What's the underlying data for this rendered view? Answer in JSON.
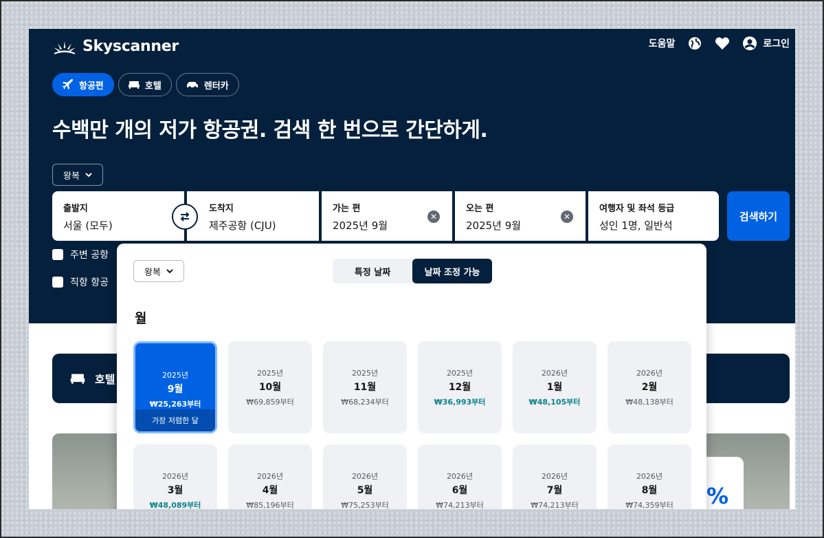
{
  "header": {
    "logo_text": "Skyscanner",
    "help": "도움말",
    "login": "로그인"
  },
  "tabs": [
    {
      "label": "항공편",
      "icon": "airplane-icon",
      "active": true
    },
    {
      "label": "호텔",
      "icon": "bed-icon",
      "active": false
    },
    {
      "label": "렌터카",
      "icon": "car-icon",
      "active": false
    }
  ],
  "headline": "수백만 개의 저가 항공권. 검색 한 번으로 간단하게.",
  "trip_type": "왕복",
  "search": {
    "origin_label": "출발지",
    "origin_value": "서울 (모두)",
    "dest_label": "도착지",
    "dest_value": "제주공항 (CJU)",
    "depart_label": "가는 편",
    "depart_value": "2025년 9월",
    "return_label": "오는 편",
    "return_value": "2025년 9월",
    "travelers_label": "여행자 및 좌석 등급",
    "travelers_value": "성인 1명, 일반석",
    "search_button": "검색하기"
  },
  "options": {
    "nearby": "주변 공항",
    "direct": "직항 항공"
  },
  "hotel_banner": "호텔",
  "promo_symbol": "%",
  "picker": {
    "trip_type": "왕복",
    "mode_specific": "특정 날짜",
    "mode_flexible": "날짜 조정 가능",
    "section_title": "월",
    "months": [
      {
        "year": "2025년",
        "month": "9월",
        "price": "₩25,263부터",
        "cheap": true,
        "selected": true,
        "tag": "가장 저렴한 달"
      },
      {
        "year": "2025년",
        "month": "10월",
        "price": "₩69,859부터",
        "cheap": false
      },
      {
        "year": "2025년",
        "month": "11월",
        "price": "₩68,234부터",
        "cheap": false
      },
      {
        "year": "2025년",
        "month": "12월",
        "price": "₩36,993부터",
        "cheap": true
      },
      {
        "year": "2026년",
        "month": "1월",
        "price": "₩48,105부터",
        "cheap": true
      },
      {
        "year": "2026년",
        "month": "2월",
        "price": "₩48,138부터",
        "cheap": false
      },
      {
        "year": "2026년",
        "month": "3월",
        "price": "₩48,089부터",
        "cheap": true
      },
      {
        "year": "2026년",
        "month": "4월",
        "price": "₩85,196부터",
        "cheap": false
      },
      {
        "year": "2026년",
        "month": "5월",
        "price": "₩75,253부터",
        "cheap": false
      },
      {
        "year": "2026년",
        "month": "6월",
        "price": "₩74,213부터",
        "cheap": false
      },
      {
        "year": "2026년",
        "month": "7월",
        "price": "₩74,213부터",
        "cheap": false
      },
      {
        "year": "2026년",
        "month": "8월",
        "price": "₩74,359부터",
        "cheap": false
      }
    ]
  },
  "colors": {
    "navy": "#05203c",
    "brand_blue": "#0062e3",
    "cheap_teal": "#0c838a"
  }
}
